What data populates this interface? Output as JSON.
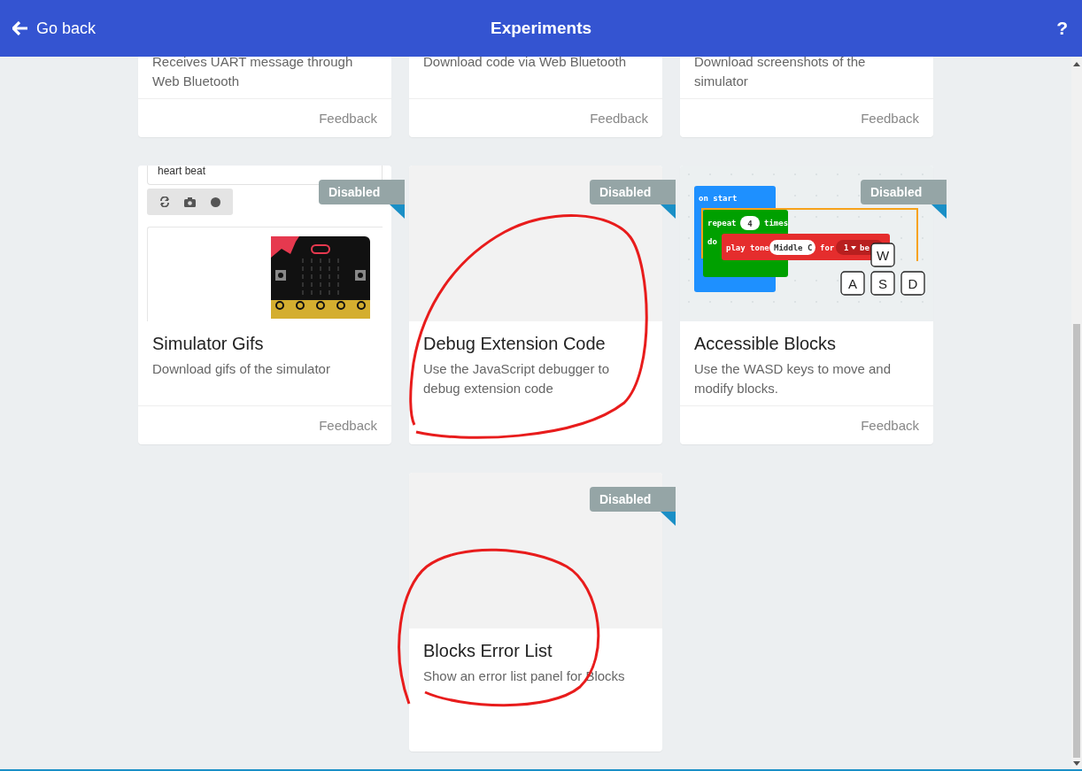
{
  "header": {
    "back_label": "Go back",
    "title": "Experiments",
    "help": "?"
  },
  "cards": [
    {
      "description": "Receives UART message through Web Bluetooth",
      "feedback": "Feedback"
    },
    {
      "description": "Download code via Web Bluetooth",
      "feedback": "Feedback"
    },
    {
      "description": "Download screenshots of the simulator",
      "feedback": "Feedback"
    },
    {
      "title": "Simulator Gifs",
      "description": "Download gifs of the simulator",
      "feedback": "Feedback",
      "disabled": true,
      "badge": "Disabled",
      "preview": {
        "kind": "simulator",
        "field_value": "heart beat"
      }
    },
    {
      "title": "Debug Extension Code",
      "description": "Use the JavaScript debugger to debug extension code",
      "disabled": true,
      "badge": "Disabled",
      "preview": {
        "kind": "blank"
      }
    },
    {
      "title": "Accessible Blocks",
      "description": "Use the WASD keys to move and modify blocks.",
      "feedback": "Feedback",
      "disabled": true,
      "badge": "Disabled",
      "preview": {
        "kind": "blocks",
        "event": "on start",
        "loop": "repeat",
        "count": "4",
        "loop_suffix": "times",
        "do": "do",
        "action": "play tone",
        "note": "Middle C",
        "for": "for",
        "beats": "1",
        "beats_unit": "be",
        "keys": [
          "W",
          "A",
          "S",
          "D"
        ]
      }
    },
    {
      "title": "Blocks Error List",
      "description": "Show an error list panel for Blocks",
      "disabled": true,
      "badge": "Disabled",
      "preview": {
        "kind": "blank"
      }
    }
  ]
}
